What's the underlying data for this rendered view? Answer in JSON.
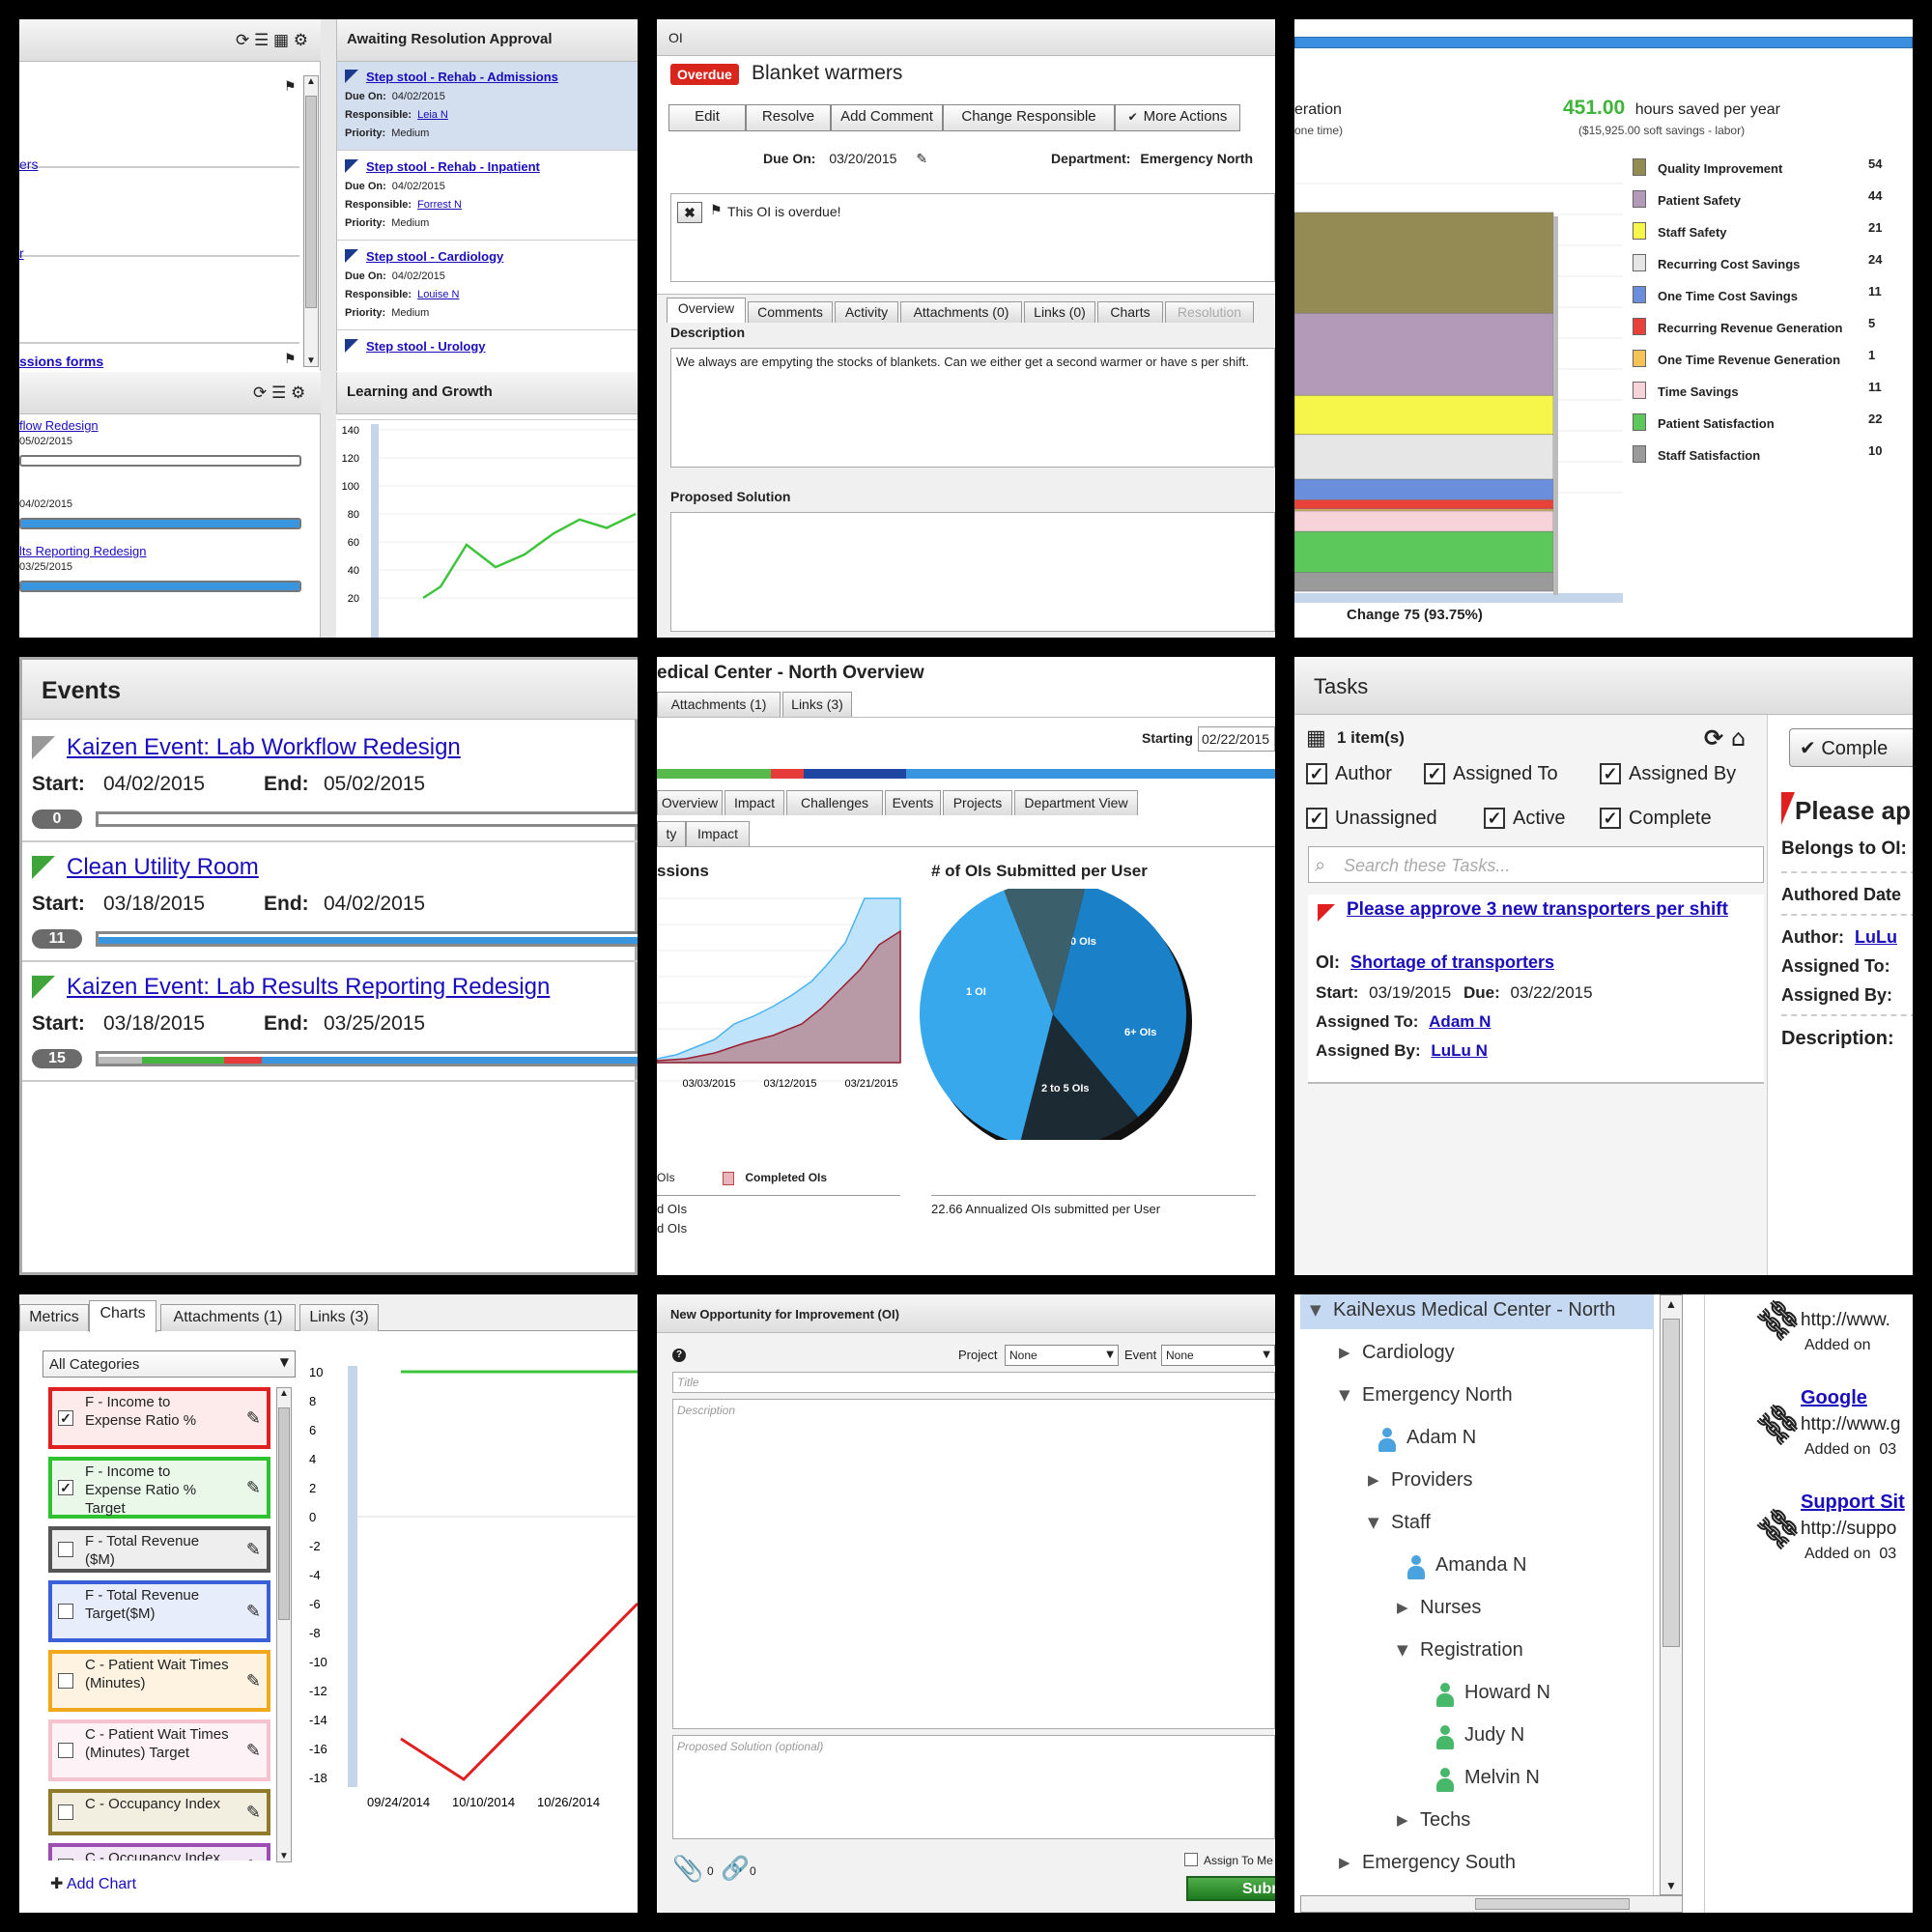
{
  "t1": {
    "icons": [
      "refresh-icon",
      "list-icon",
      "grid-icon",
      "gear-icon",
      "flag-icon"
    ],
    "left_links": [
      "ers",
      "r",
      "ssions forms"
    ],
    "panel_title": "Awaiting Resolution Approval",
    "labels": {
      "due": "Due On:",
      "resp": "Responsible:",
      "prio": "Priority:"
    },
    "items": [
      {
        "title": "Step stool - Rehab - Admissions",
        "due": "04/02/2015",
        "resp": "Leia N",
        "prio": "Medium"
      },
      {
        "title": "Step stool - Rehab - Inpatient",
        "due": "04/02/2015",
        "resp": "Forrest N",
        "prio": "Medium"
      },
      {
        "title": "Step stool - Cardiology",
        "due": "04/02/2015",
        "resp": "Louise N",
        "prio": "Medium"
      },
      {
        "title": "Step stool - Urology"
      }
    ],
    "events_left": [
      {
        "title": "flow Redesign",
        "date": "05/02/2015",
        "progress": 0
      },
      {
        "title": "",
        "date": "04/02/2015",
        "progress": 1
      },
      {
        "title": "lts Reporting Redesign",
        "date": "03/25/2015",
        "progress": 1
      }
    ],
    "chart_title": "Learning and Growth"
  },
  "t2": {
    "header": "OI",
    "badge": "Overdue",
    "title": "Blanket warmers",
    "buttons": [
      "Edit",
      "Resolve",
      "Add Comment",
      "Change Responsible",
      "More Actions"
    ],
    "due_label": "Due On:",
    "due": "03/20/2015",
    "dept_label": "Department:",
    "dept": "Emergency North",
    "alert": "This OI is overdue!",
    "tabs": [
      "Overview",
      "Comments",
      "Activity",
      "Attachments (0)",
      "Links (0)",
      "Charts",
      "Resolution"
    ],
    "desc_label": "Description",
    "desc": "We always are empyting the stocks of blankets.  Can we either get a second warmer or have s per shift.",
    "sol_label": "Proposed Solution"
  },
  "t3": {
    "left_text": "eration",
    "left_sub": "one time)",
    "hours": "451.00",
    "hours_label": "hours saved per year",
    "savings": "($15,925.00 soft savings - labor)",
    "legend": [
      {
        "name": "Quality Improvement",
        "value": "54",
        "color": "#948a54"
      },
      {
        "name": "Patient Safety",
        "value": "44",
        "color": "#b29ab8"
      },
      {
        "name": "Staff Safety",
        "value": "21",
        "color": "#f5f54a"
      },
      {
        "name": "Recurring Cost Savings",
        "value": "24",
        "color": "#e6e6e6"
      },
      {
        "name": "One Time Cost Savings",
        "value": "11",
        "color": "#6a8edc"
      },
      {
        "name": "Recurring Revenue Generation",
        "value": "5",
        "color": "#e8413a"
      },
      {
        "name": "One Time Revenue Generation",
        "value": "1",
        "color": "#f7c258"
      },
      {
        "name": "Time Savings",
        "value": "11",
        "color": "#f5d3d8"
      },
      {
        "name": "Patient Satisfaction",
        "value": "22",
        "color": "#5cc75a"
      },
      {
        "name": "Staff Satisfaction",
        "value": "10",
        "color": "#9a9a9a"
      }
    ],
    "change": "Change 75 (93.75%)"
  },
  "t4": {
    "title": "Events",
    "start_label": "Start:",
    "end_label": "End:",
    "events": [
      {
        "title": "Kaizen Event: Lab Workflow Redesign",
        "start": "04/02/2015",
        "end": "05/02/2015",
        "count": "0",
        "flag": "#999999"
      },
      {
        "title": "Clean Utility Room",
        "start": "03/18/2015",
        "end": "04/02/2015",
        "count": "11",
        "flag": "#3fa53a"
      },
      {
        "title": "Kaizen Event: Lab Results Reporting Redesign",
        "start": "03/18/2015",
        "end": "03/25/2015",
        "count": "15",
        "flag": "#3fa53a"
      }
    ]
  },
  "t5": {
    "title": "edical Center - North Overview",
    "top_tabs": [
      "Attachments (1)",
      "Links (3)"
    ],
    "starting_label": "Starting",
    "starting": "02/22/2015",
    "tabs": [
      "Overview",
      "Impact",
      "Challenges",
      "Events",
      "Projects",
      "Department View"
    ],
    "subtabs": [
      "ty",
      "Impact"
    ],
    "left_title": "ssions",
    "pie_title": "# of OIs Submitted per User",
    "dates": [
      "03/03/2015",
      "03/12/2015",
      "03/21/2015"
    ],
    "legend": [
      "OIs",
      "Completed OIs"
    ],
    "left_foot": [
      "d OIs",
      "d OIs"
    ],
    "annual": "22.66 Annualized OIs submitted per User",
    "pie": [
      {
        "label": "0 OIs",
        "pct": 0.35,
        "color": "#1a80c8"
      },
      {
        "label": "6+ OIs",
        "pct": 0.15,
        "color": "#1c2a33"
      },
      {
        "label": "2 to 5 OIs",
        "pct": 0.4,
        "color": "#37a8ec"
      },
      {
        "label": "1 OI",
        "pct": 0.1,
        "color": "#3c5f6c"
      }
    ]
  },
  "t6": {
    "title": "Tasks",
    "count": "1 item(s)",
    "filters": [
      "Author",
      "Assigned To",
      "Assigned By",
      "Unassigned",
      "Active",
      "Complete"
    ],
    "search_ph": "Search these Tasks...",
    "task": {
      "title": "Please approve 3 new transporters per shift",
      "oi_label": "OI:",
      "oi": "Shortage of transporters",
      "start_label": "Start:",
      "start": "03/19/2015",
      "due_label": "Due:",
      "due": "03/22/2015",
      "at_label": "Assigned To:",
      "at": "Adam N",
      "ab_label": "Assigned By:",
      "ab": "LuLu N"
    },
    "right": {
      "btn": "Comple",
      "title": "Please ap",
      "belongs": "Belongs to OI:",
      "authored": "Authored Date",
      "author_label": "Author:",
      "author": "LuLu",
      "at_label": "Assigned To:",
      "ab_label": "Assigned By:",
      "desc_label": "Description:"
    }
  },
  "t7": {
    "tabs": [
      "Metrics",
      "Charts",
      "Attachments (1)",
      "Links (3)"
    ],
    "select": "All Categories",
    "items": [
      {
        "label": "F - Income to Expense Ratio %",
        "checked": true,
        "color": "#e02020",
        "bg": "#fdeaea"
      },
      {
        "label": "F - Income to Expense Ratio % Target",
        "checked": true,
        "color": "#2ec22e",
        "bg": "#eaf8ea"
      },
      {
        "label": "F - Total Revenue ($M)",
        "checked": false,
        "color": "#555555",
        "bg": "#eeeeee"
      },
      {
        "label": "F - Total Revenue Target($M)",
        "checked": false,
        "color": "#3a5fd9",
        "bg": "#e8edfb"
      },
      {
        "label": "C - Patient Wait Times (Minutes)",
        "checked": false,
        "color": "#f2a81c",
        "bg": "#fdf3e0"
      },
      {
        "label": "C - Patient Wait Times (Minutes) Target",
        "checked": false,
        "color": "#f5c2cf",
        "bg": "#fdf2f5"
      },
      {
        "label": "C - Occupancy Index",
        "checked": false,
        "color": "#8f7b2a",
        "bg": "#f2efe0"
      },
      {
        "label": "C - Occupancy Index Target",
        "checked": false,
        "color": "#9c4fb0",
        "bg": "#f3e9f6"
      }
    ],
    "add": "Add Chart",
    "chart": {
      "yticks": [
        "10",
        "8",
        "6",
        "4",
        "2",
        "0",
        "-2",
        "-4",
        "-6",
        "-8",
        "-10",
        "-12",
        "-14",
        "-16",
        "-18"
      ],
      "xticks": [
        "09/24/2014",
        "10/10/2014",
        "10/26/2014"
      ]
    }
  },
  "t8": {
    "title": "New Opportunity for Improvement (OI)",
    "project_label": "Project",
    "project": "None",
    "event_label": "Event",
    "event": "None",
    "title_ph": "Title",
    "desc_ph": "Description",
    "sol_ph": "Proposed Solution (optional)",
    "attach": "0",
    "links": "0",
    "assign": "Assign To Me",
    "submit": "Subm"
  },
  "t9": {
    "tree": [
      {
        "label": "KaiNexus Medical Center - North",
        "kind": "open",
        "level": 0,
        "selected": true
      },
      {
        "label": "Cardiology",
        "kind": "closed",
        "level": 1
      },
      {
        "label": "Emergency North",
        "kind": "open",
        "level": 1
      },
      {
        "label": "Adam N",
        "kind": "user-blue",
        "level": 2
      },
      {
        "label": "Providers",
        "kind": "closed",
        "level": 2
      },
      {
        "label": "Staff",
        "kind": "open",
        "level": 2
      },
      {
        "label": "Amanda N",
        "kind": "user-blue",
        "level": 3
      },
      {
        "label": "Nurses",
        "kind": "closed",
        "level": 3
      },
      {
        "label": "Registration",
        "kind": "open",
        "level": 3
      },
      {
        "label": "Howard N",
        "kind": "user-green",
        "level": 4
      },
      {
        "label": "Judy N",
        "kind": "user-green",
        "level": 4
      },
      {
        "label": "Melvin N",
        "kind": "user-green",
        "level": 4
      },
      {
        "label": "Techs",
        "kind": "closed",
        "level": 3
      },
      {
        "label": "Emergency South",
        "kind": "closed",
        "level": 1
      }
    ],
    "links": [
      {
        "name": "",
        "url": "http://www.",
        "added": "Added on"
      },
      {
        "name": "Google",
        "url": "http://www.g",
        "added": "Added on  03"
      },
      {
        "name": "Support Sit",
        "url": "http://suppo",
        "added": "Added on  03"
      }
    ]
  }
}
